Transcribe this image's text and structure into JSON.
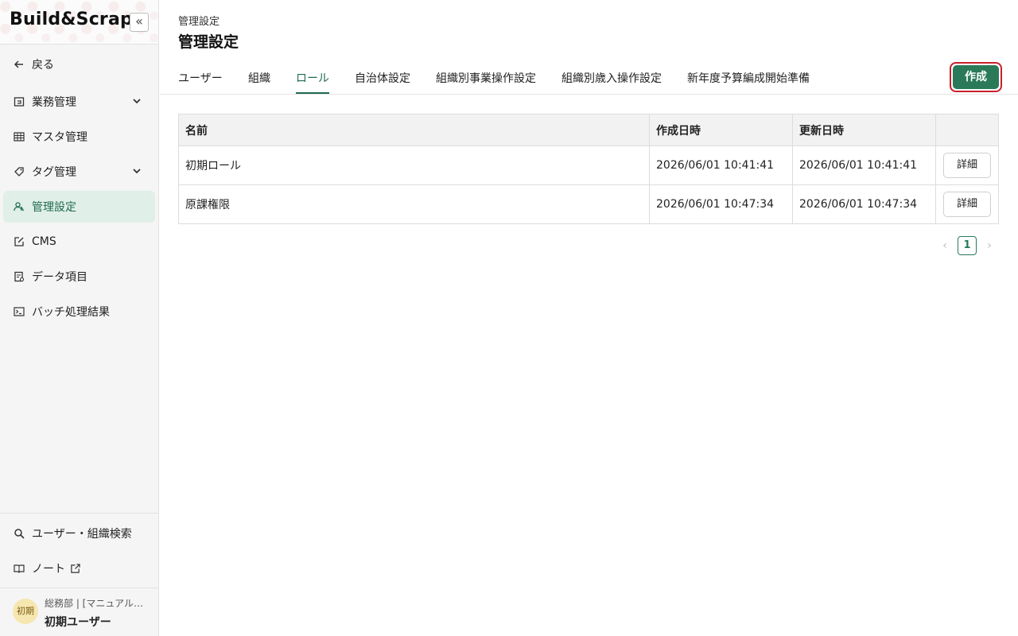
{
  "app": {
    "logo_text": "Build&Scrap"
  },
  "sidebar": {
    "collapse_symbol": "«",
    "back_label": "戻る",
    "items": [
      {
        "label": "業務管理",
        "icon": "business-icon",
        "has_chevron": true
      },
      {
        "label": "マスタ管理",
        "icon": "table-icon",
        "has_chevron": false
      },
      {
        "label": "タグ管理",
        "icon": "tag-icon",
        "has_chevron": true
      },
      {
        "label": "管理設定",
        "icon": "people-icon",
        "has_chevron": false,
        "active": true
      },
      {
        "label": "CMS",
        "icon": "edit-icon",
        "has_chevron": false
      },
      {
        "label": "データ項目",
        "icon": "document-icon",
        "has_chevron": false
      },
      {
        "label": "バッチ処理結果",
        "icon": "terminal-icon",
        "has_chevron": false
      }
    ],
    "bottom_items": [
      {
        "label": "ユーザー・組織検索",
        "icon": "search-icon"
      },
      {
        "label": "ノート",
        "icon": "book-icon"
      }
    ],
    "user": {
      "avatar_text": "初期",
      "org": "総務部 | [マニュアル…",
      "name": "初期ユーザー"
    }
  },
  "header": {
    "breadcrumb": "管理設定",
    "title": "管理設定"
  },
  "tabs": [
    {
      "label": "ユーザー"
    },
    {
      "label": "組織"
    },
    {
      "label": "ロール",
      "active": true
    },
    {
      "label": "自治体設定"
    },
    {
      "label": "組織別事業操作設定"
    },
    {
      "label": "組織別歳入操作設定"
    },
    {
      "label": "新年度予算編成開始準備"
    }
  ],
  "create_button_label": "作成",
  "table": {
    "columns": [
      "名前",
      "作成日時",
      "更新日時",
      ""
    ],
    "rows": [
      {
        "name": "初期ロール",
        "created": "2026/06/01 10:41:41",
        "updated": "2026/06/01 10:41:41",
        "action": "詳細"
      },
      {
        "name": "原課権限",
        "created": "2026/06/01 10:47:34",
        "updated": "2026/06/01 10:47:34",
        "action": "詳細"
      }
    ]
  },
  "pagination": {
    "current_page": "1",
    "prev": "‹",
    "next": "›"
  },
  "colors": {
    "accent": "#2a7a5a",
    "active_bg": "#e0efe8",
    "highlight_border": "#c8202a"
  }
}
